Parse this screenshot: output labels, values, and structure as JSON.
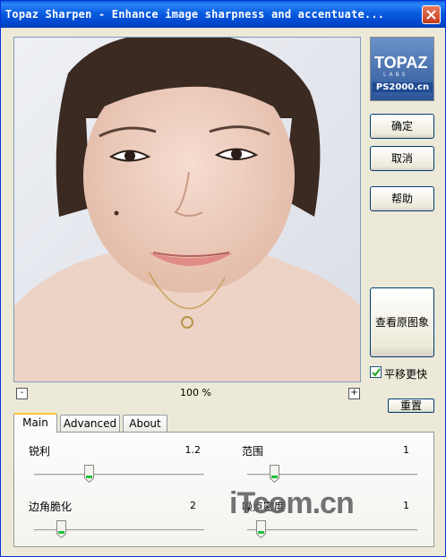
{
  "window": {
    "title": "Topaz Sharpen - Enhance image sharpness and accentuate..."
  },
  "logo": {
    "line1": "TOPAZ",
    "line2": "LABS",
    "line3": "PS2000.cn"
  },
  "buttons": {
    "ok": "确定",
    "cancel": "取消",
    "help": "帮助",
    "view_original": "查看原图象",
    "reset": "重置"
  },
  "pan_faster": {
    "label": "平移更快",
    "checked": true
  },
  "zoom": {
    "minus": "-",
    "plus": "+",
    "level": "100 %"
  },
  "tabs": [
    {
      "label": "Main",
      "active": true
    },
    {
      "label": "Advanced",
      "active": false
    },
    {
      "label": "About",
      "active": false
    }
  ],
  "main": {
    "sharpen": {
      "label": "锐利",
      "value": "1.2",
      "level": 0.32
    },
    "range": {
      "label": "范围",
      "value": "1",
      "level": 0.16
    },
    "edge_softening": {
      "label": "边角脆化",
      "value": "2",
      "level": 0.16
    },
    "noise_density": {
      "label": "噪点密度",
      "value": "1",
      "level": 0.08
    }
  },
  "watermark": {
    "text": "iTcom.cn"
  },
  "icons": {
    "close": "close-icon",
    "check": "check-icon"
  },
  "colors": {
    "titlebar": "#0a5de0",
    "tab_highlight": "#ffc83c",
    "button_border": "#003c74",
    "watermark": "#5a5a5a"
  }
}
